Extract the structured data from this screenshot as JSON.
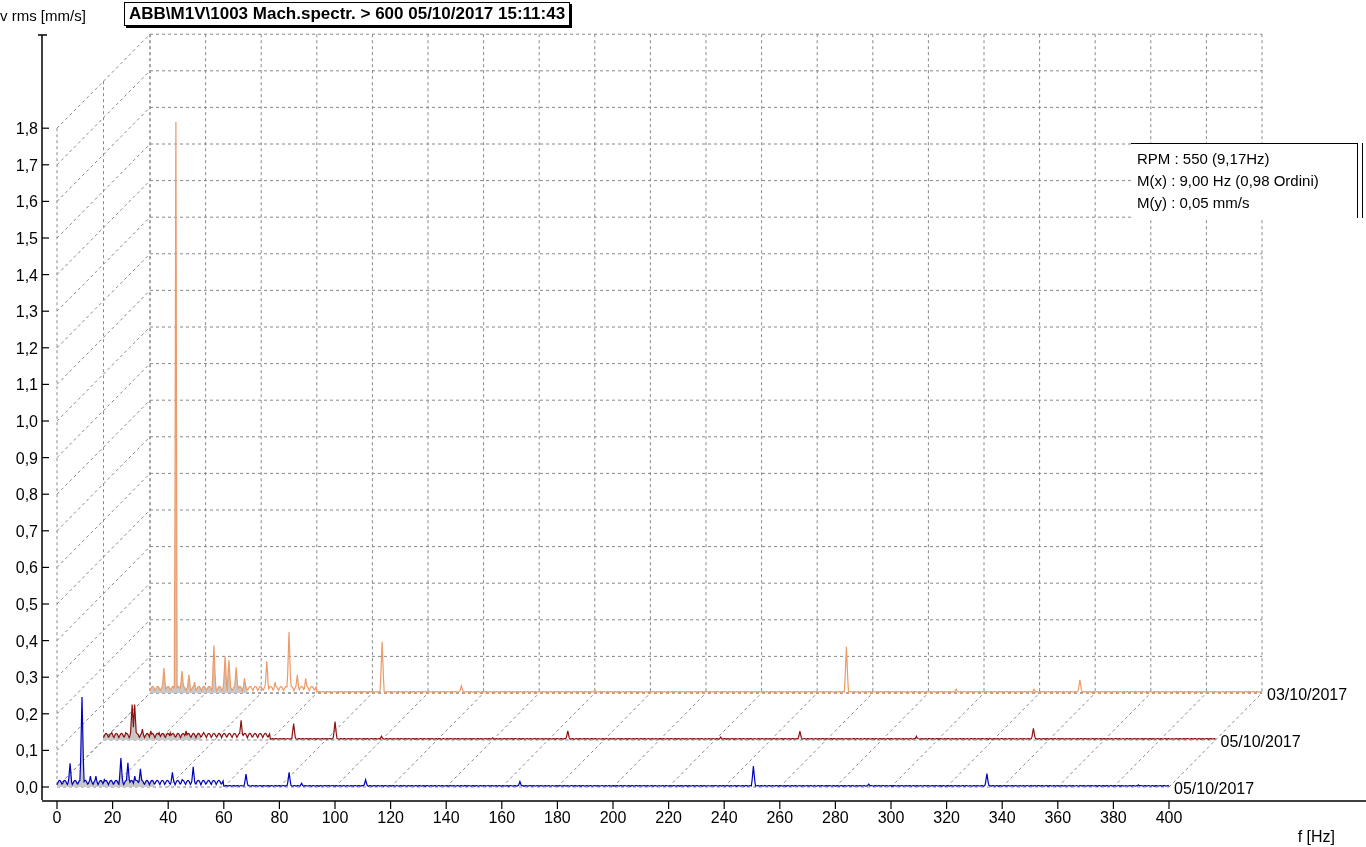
{
  "title": "ABB\\M1V\\1003 Mach.spectr. > 600 05/10/2017 15:11:43",
  "y_axis": {
    "title": "v rms [mm/s]",
    "ticks": [
      "1,8",
      "1,7",
      "1,6",
      "1,5",
      "1,4",
      "1,3",
      "1,2",
      "1,1",
      "1,0",
      "0,9",
      "0,8",
      "0,7",
      "0,6",
      "0,5",
      "0,4",
      "0,3",
      "0,2",
      "0,1",
      "0,0"
    ]
  },
  "x_axis": {
    "title": "f [Hz]",
    "ticks": [
      "0",
      "20",
      "40",
      "60",
      "80",
      "100",
      "120",
      "140",
      "160",
      "180",
      "200",
      "220",
      "240",
      "260",
      "280",
      "300",
      "320",
      "340",
      "360",
      "380",
      "400"
    ]
  },
  "traces": [
    {
      "label": "03/10/2017",
      "color": "#ee9966"
    },
    {
      "label": "05/10/2017",
      "color": "#8b1010"
    },
    {
      "label": "05/10/2017",
      "color": "#0000c0"
    }
  ],
  "readout": [
    "RPM : 550 (9,17Hz)",
    "M(x) : 9,00 Hz (0,98 Ordini)",
    "M(y) : 0,05 mm/s"
  ]
}
